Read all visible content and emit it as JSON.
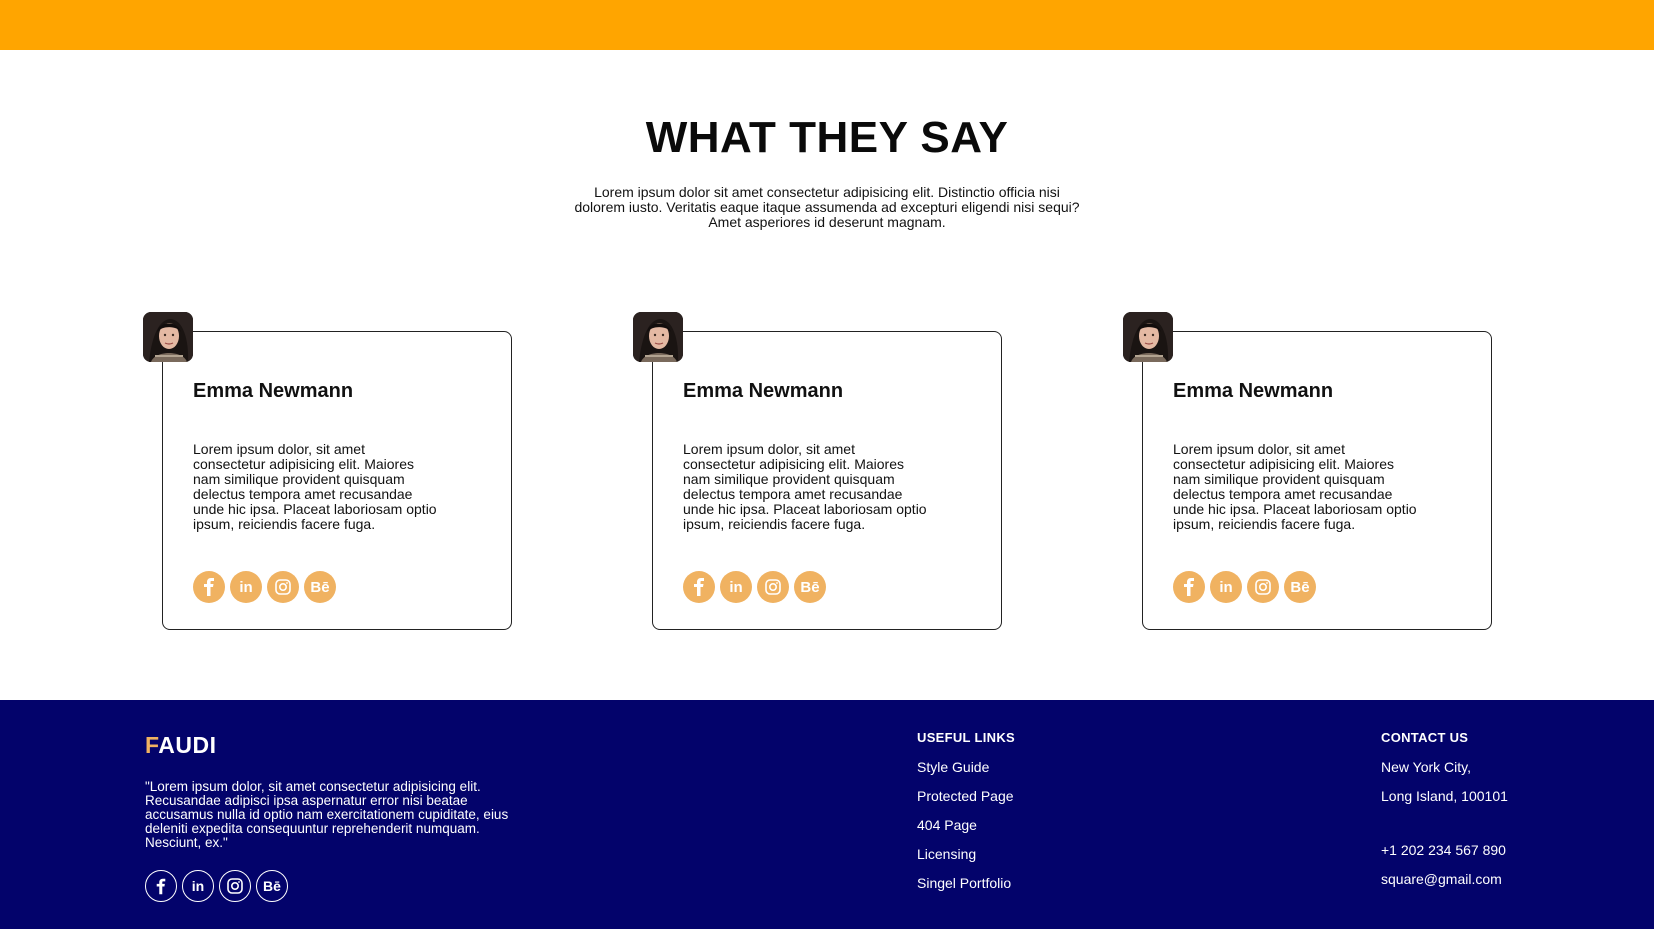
{
  "section": {
    "title": "WHAT THEY SAY",
    "description": "Lorem ipsum dolor sit amet consectetur adipisicing elit. Distinctio officia nisi dolorem iusto. Veritatis eaque itaque assumenda ad excepturi eligendi nisi sequi? Amet asperiores id deserunt magnam."
  },
  "testimonials": [
    {
      "name": "Emma Newmann",
      "quote": "Lorem ipsum dolor, sit amet consectetur adipisicing elit. Maiores nam similique provident quisquam delectus tempora amet recusandae unde hic ipsa. Placeat laboriosam optio ipsum, reiciendis facere fuga."
    },
    {
      "name": "Emma Newmann",
      "quote": "Lorem ipsum dolor, sit amet consectetur adipisicing elit. Maiores nam similique provident quisquam delectus tempora amet recusandae unde hic ipsa. Placeat laboriosam optio ipsum, reiciendis facere fuga."
    },
    {
      "name": "Emma Newmann",
      "quote": "Lorem ipsum dolor, sit amet consectetur adipisicing elit. Maiores nam similique provident quisquam delectus tempora amet recusandae unde hic ipsa. Placeat laboriosam optio ipsum, reiciendis facere fuga."
    }
  ],
  "social_icons": [
    "facebook-icon",
    "linkedin-icon",
    "instagram-icon",
    "behance-icon"
  ],
  "social_labels": {
    "linkedin": "in",
    "behance": "Bē"
  },
  "footer": {
    "brand_first": "F",
    "brand_rest": "AUDI",
    "about": "\"Lorem ipsum dolor, sit amet consectetur adipisicing elit. Recusandae adipisci ipsa aspernatur error nisi beatae accusamus nulla id optio nam exercitationem cupiditate, eius deleniti expedita consequuntur reprehenderit numquam. Nesciunt, ex.\"",
    "useful_links": {
      "title": "USEFUL LINKS",
      "items": [
        "Style Guide",
        "Protected Page",
        "404 Page",
        "Licensing",
        "Singel Portfolio"
      ]
    },
    "contact": {
      "title": "CONTACT US",
      "city": "New York City,",
      "address": "Long Island, 100101",
      "phone": "+1 202 234 567 890",
      "email": "square@gmail.com"
    }
  },
  "colors": {
    "accent": "#ffa500",
    "social_fill": "#f0b261",
    "footer_bg": "#03036b"
  }
}
